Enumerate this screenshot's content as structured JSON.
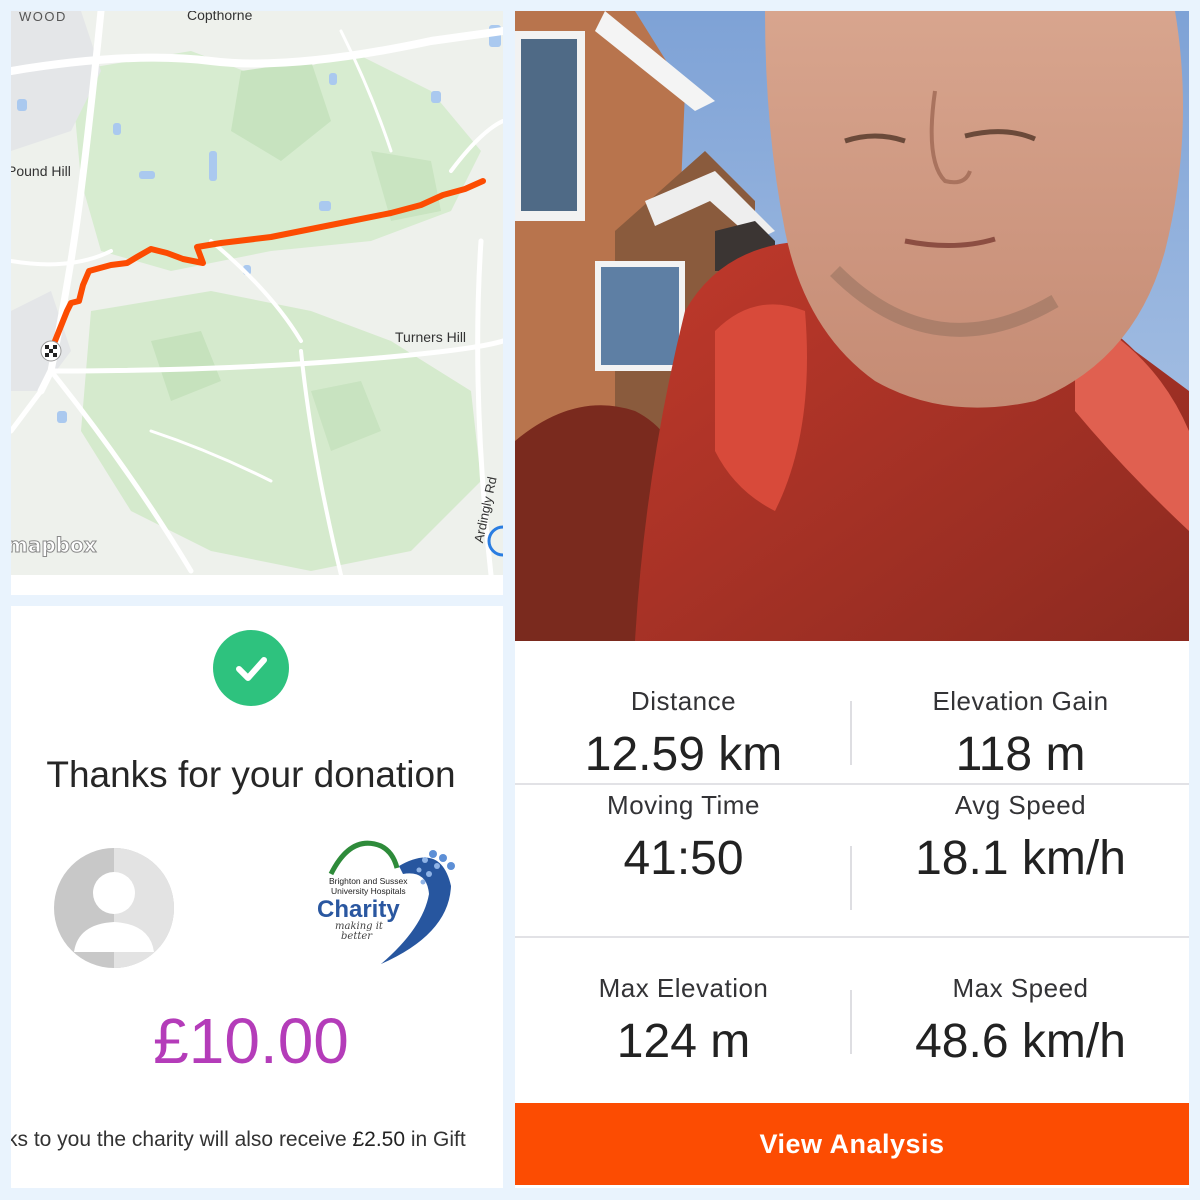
{
  "map": {
    "labels": {
      "wood": "WOOD",
      "copthorne": "Copthorne",
      "pound_hill": "Pound Hill",
      "turners_hill": "Turners Hill",
      "ardingly_rd": "Ardingly Rd"
    },
    "attribution": "mapbox",
    "route_color": "#fc4c02"
  },
  "donation": {
    "title": "Thanks for your donation",
    "charity_logo": {
      "line1": "Brighton and Sussex",
      "line2": "University Hospitals",
      "name": "Charity",
      "tagline1": "making it",
      "tagline2": "better"
    },
    "amount": "£10.00",
    "gift_aid_prefix": "ks to you the charity will also receive ",
    "gift_aid_amount": "£2.50",
    "gift_aid_suffix": " in Gift",
    "success_color": "#2ec27e",
    "amount_color": "#b43cb9"
  },
  "stats": {
    "rows": [
      [
        {
          "label": "Distance",
          "value": "12.59 km"
        },
        {
          "label": "Elevation Gain",
          "value": "118 m"
        }
      ],
      [
        {
          "label": "Moving Time",
          "value": "41:50"
        },
        {
          "label": "Avg Speed",
          "value": "18.1 km/h"
        }
      ],
      [
        {
          "label": "Max Elevation",
          "value": "124 m"
        },
        {
          "label": "Max Speed",
          "value": "48.6 km/h"
        }
      ]
    ],
    "button_label": "View Analysis",
    "accent_color": "#fc4c02"
  }
}
